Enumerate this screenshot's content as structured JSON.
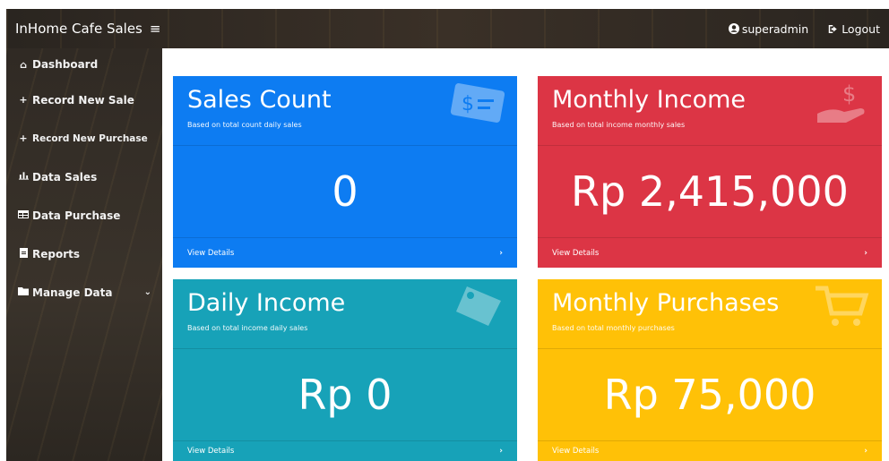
{
  "header": {
    "brand": "InHome Cafe Sales",
    "menu_icon": "hamburger-icon",
    "user_label": "superadmin",
    "logout_label": "Logout"
  },
  "sidebar": {
    "items": [
      {
        "icon": "home-icon",
        "label": "Dashboard"
      },
      {
        "icon": "plus-icon",
        "label": "Record New Sale"
      },
      {
        "icon": "plus-icon",
        "label": "Record New Purchase"
      },
      {
        "icon": "chart-icon",
        "label": "Data Sales"
      },
      {
        "icon": "table-icon",
        "label": "Data Purchase"
      },
      {
        "icon": "file-icon",
        "label": "Reports"
      },
      {
        "icon": "folder-icon",
        "label": "Manage Data"
      }
    ]
  },
  "cards": {
    "sales_count": {
      "title": "Sales Count",
      "subtitle": "Based on total count daily sales",
      "value": "0",
      "link": "View Details",
      "color": "#0d7cf2"
    },
    "monthly_income": {
      "title": "Monthly Income",
      "subtitle": "Based on total income monthly sales",
      "value": "Rp 2,415,000",
      "link": "View Details",
      "color": "#dc3545"
    },
    "daily_income": {
      "title": "Daily Income",
      "subtitle": "Based on total income daily sales",
      "value": "Rp 0",
      "link": "View Details",
      "color": "#17a2b8"
    },
    "monthly_purchases": {
      "title": "Monthly Purchases",
      "subtitle": "Based on total monthly purchases",
      "value": "Rp 75,000",
      "link": "View Details",
      "color": "#ffc107"
    }
  }
}
